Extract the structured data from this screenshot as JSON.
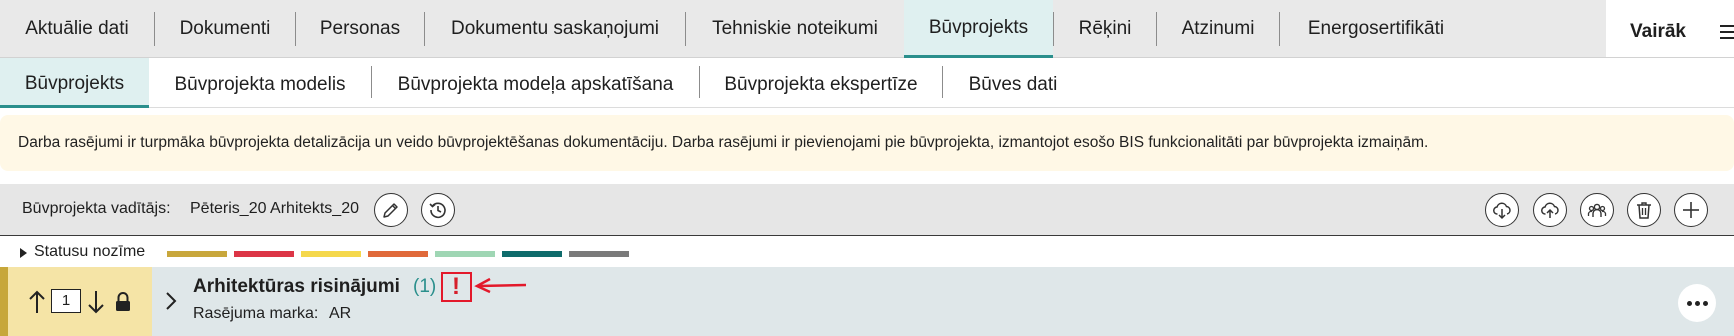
{
  "top_tabs": [
    {
      "label": "Aktuālie dati"
    },
    {
      "label": "Dokumenti"
    },
    {
      "label": "Personas"
    },
    {
      "label": "Dokumentu saskaņojumi"
    },
    {
      "label": "Tehniskie noteikumi"
    },
    {
      "label": "Būvprojekts",
      "active": true
    },
    {
      "label": "Rēķini"
    },
    {
      "label": "Atzinumi"
    },
    {
      "label": "Energosertifikāti"
    }
  ],
  "more_label": "Vairāk",
  "sub_tabs": [
    {
      "label": "Būvprojekts",
      "active": true
    },
    {
      "label": "Būvprojekta modelis"
    },
    {
      "label": "Būvprojekta modeļa apskatīšana"
    },
    {
      "label": "Būvprojekta ekspertīze"
    },
    {
      "label": "Būves dati"
    }
  ],
  "info_text": "Darba rasējumi ir turpmāka būvprojekta detalizācija un veido būvprojektēšanas dokumentāciju. Darba rasējumi ir pievienojami pie būvprojekta, izmantojot esošo BIS funkcionalitāti par būvprojekta izmaiņām.",
  "manager": {
    "label": "Būvprojekta vadītājs:",
    "name": "Pēteris_20 Arhitekts_20"
  },
  "toolbar_icons": [
    "cloud-download-icon",
    "cloud-upload-icon",
    "group-icon",
    "trash-icon",
    "plus-icon"
  ],
  "legend": {
    "label": "Statusu nozīme",
    "colors": [
      "#c8a73c",
      "#dc3546",
      "#f5d84c",
      "#e0693a",
      "#9fd6b4",
      "#0e6b6b",
      "#7a7a7a"
    ]
  },
  "section": {
    "order": "1",
    "title": "Arhitektūras risinājumi",
    "count": "(1)",
    "alert": "!",
    "mark_label": "Rasējuma marka:",
    "mark_value": "AR"
  },
  "colors": {
    "accent": "#2a8f8c",
    "alert": "#e3192b"
  }
}
